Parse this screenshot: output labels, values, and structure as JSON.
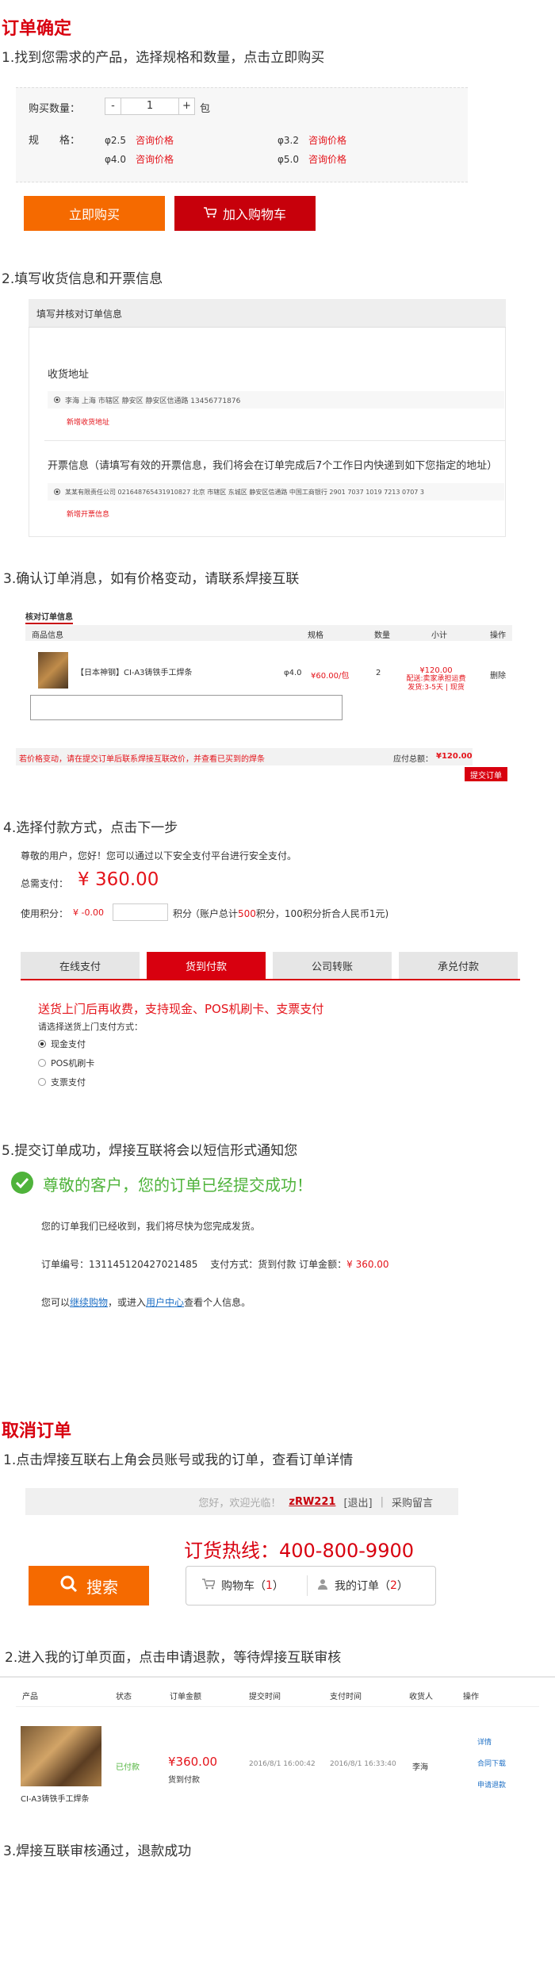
{
  "s1": {
    "title": "订单确定",
    "step1": "1.找到您需求的产品，选择规格和数量，点击立即购买",
    "qty_label": "购买数量：",
    "qty_minus": "-",
    "qty_value": "1",
    "qty_plus": "+",
    "qty_unit": "包",
    "spec_label": "规　　格：",
    "specs": [
      {
        "size": "φ2.5",
        "price": "咨询价格"
      },
      {
        "size": "φ3.2",
        "price": "咨询价格"
      },
      {
        "size": "φ4.0",
        "price": "咨询价格"
      },
      {
        "size": "φ5.0",
        "price": "咨询价格"
      }
    ],
    "buy_now": "立即购买",
    "add_cart": "加入购物车"
  },
  "s2": {
    "step": "2.填写收货信息和开票信息",
    "panel_title": "填写并核对订单信息",
    "addr_title": "收货地址",
    "addr_line": "李海 上海 市辖区 静安区 静安区信通路 13456771876",
    "addr_add": "新增收货地址",
    "inv_title": "开票信息（请填写有效的开票信息，我们将会在订单完成后7个工作日内快递到如下您指定的地址）",
    "inv_line": "某某有限责任公司 021648765431910827 北京 市辖区 东城区 静安区信通路 中国工商银行 2901 7037 1019 7213 0707 3",
    "inv_add": "新增开票信息"
  },
  "s3": {
    "step": "3.确认订单消息，如有价格变动，请联系焊接互联",
    "panel_title": "核对订单信息",
    "headers": [
      "商品信息",
      "规格",
      "数量",
      "小计",
      "操作"
    ],
    "item_name": "【日本神钢】CI-A3铸铁手工焊条",
    "item_spec": "φ4.0",
    "item_price": "¥60.00/包",
    "item_qty": "2",
    "item_sub": "¥120.00",
    "item_note1": "配送:卖家承担运费",
    "item_note2": "发货:3-5天 | 现货",
    "item_op": "删除",
    "notice": "若价格变动，请在提交订单后联系焊接互联改价，并查看已买到的焊条",
    "total_label": "应付总额：",
    "total": "¥120.00",
    "submit": "提交订单"
  },
  "s4": {
    "step": "4.选择付款方式，点击下一步",
    "greet": "尊敬的用户，您好！您可以通过以下安全支付平台进行安全支付。",
    "need_label": "总需支付：",
    "need": "¥ 360.00",
    "pts_label": "使用积分：",
    "pts_val": "¥ -0.00",
    "pts_unit": "积分",
    "pts_note_pre": "（账户总计",
    "pts_total": "500",
    "pts_note_post": "积分，100积分折合人民币1元)",
    "tabs": [
      "在线支付",
      "货到付款",
      "公司转账",
      "承兑付款"
    ],
    "cod_title": "送货上门后再收费，支持现金、POS机刷卡、支票支付",
    "cod_sub": "请选择送货上门支付方式：",
    "options": [
      "现金支付",
      "POS机刷卡",
      "支票支付"
    ]
  },
  "s5": {
    "step": "5.提交订单成功，焊接互联将会以短信形式通知您",
    "success": "尊敬的客户，您的订单已经提交成功！",
    "l1": "您的订单我们已经收到，我们将尽快为您完成发货。",
    "order_no": "订单编号：131145120427021485",
    "pay": "支付方式：货到付款",
    "amt_label": "订单金额：",
    "amt": "¥ 360.00",
    "l3_pre": "您可以",
    "l3_link1": "继续购物",
    "l3_mid": "，或进入",
    "l3_link2": "用户中心",
    "l3_post": "查看个人信息。"
  },
  "s6": {
    "title": "取消订单",
    "step1": "1.点击焊接互联右上角会员账号或我的订单，查看订单详情",
    "welcome": "您好，欢迎光临！",
    "user": "zRW221",
    "logout": "[退出]",
    "sep": "|",
    "purchase": "采购留言",
    "hotline": "订货热线：400-800-9900",
    "search": "搜索",
    "cart_label": "购物车（",
    "cart_n": "1",
    "cart_end": "）",
    "myorder_label": "我的订单（",
    "myorder_n": "2",
    "myorder_end": "）",
    "step2": "2.进入我的订单页面，点击申请退款，等待焊接互联审核",
    "headers": [
      "产品",
      "状态",
      "订单金额",
      "提交时间",
      "支付时间",
      "收货人",
      "操作"
    ],
    "prod": "CI-A3铸铁手工焊条",
    "status": "已付款",
    "amount": "¥360.00",
    "paytype": "货到付款",
    "submit_time": "2016/8/1 16:00:42",
    "pay_time": "2016/8/1 16:33:40",
    "receiver": "李海",
    "ops": [
      "详情",
      "合同下载",
      "申请退款"
    ],
    "step3": "3.焊接互联审核通过，退款成功"
  },
  "colors": {
    "accent": "#d8000f",
    "orange": "#f56a00",
    "green": "#4fb33b"
  }
}
